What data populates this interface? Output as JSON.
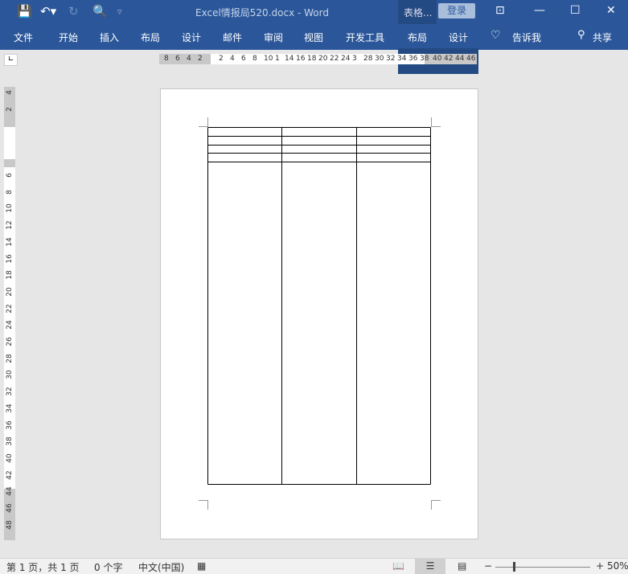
{
  "titlebar": {
    "title": "Excel情报局520.docx  -  Word",
    "context_label": "表格...",
    "login": "登录",
    "icons": [
      "save-icon",
      "undo-icon",
      "redo-icon",
      "print-preview-icon",
      "customize-icon"
    ]
  },
  "ribbon": {
    "tabs": [
      "文件",
      "开始",
      "插入",
      "布局",
      "设计",
      "邮件",
      "审阅",
      "视图",
      "开发工具"
    ],
    "context_tabs": [
      "布局",
      "设计"
    ],
    "tell_me": "告诉我",
    "share": "共享"
  },
  "ruler": {
    "h_left": [
      "8",
      "6",
      "4",
      "2"
    ],
    "h_mid1": [
      "2",
      "4",
      "6",
      "8",
      "10",
      "1"
    ],
    "h_mid2": [
      "14",
      "16",
      "18",
      "20",
      "22",
      "24"
    ],
    "h_mid3": [
      "3",
      "28",
      "30",
      "32",
      "34",
      "36",
      "38"
    ],
    "h_right": [
      "40",
      "42",
      "44",
      "46"
    ],
    "v_top": [
      "4",
      "2"
    ],
    "v": [
      "6",
      "8",
      "10",
      "12",
      "14",
      "16",
      "18",
      "20",
      "22",
      "24",
      "26",
      "28",
      "30",
      "32",
      "34",
      "36",
      "38",
      "40",
      "42",
      "44",
      "46",
      "48"
    ]
  },
  "table": {
    "columns": 3,
    "rows": 5
  },
  "status": {
    "page": "第 1 页，共 1 页",
    "words": "0 个字",
    "lang": "中文(中国)",
    "zoom": "50%",
    "zoom_fraction": 0.5
  }
}
